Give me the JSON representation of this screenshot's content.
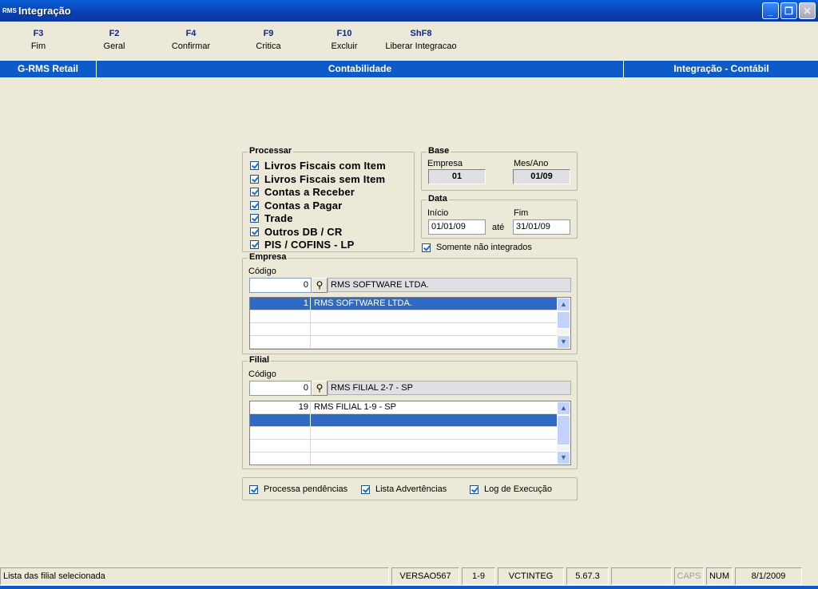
{
  "window": {
    "title": "Integração",
    "app_icon_text": "RMS"
  },
  "fkeys": [
    {
      "key": "F3",
      "label": "Fim"
    },
    {
      "key": "F2",
      "label": "Geral"
    },
    {
      "key": "F4",
      "label": "Confirmar"
    },
    {
      "key": "F9",
      "label": "Critica"
    },
    {
      "key": "F10",
      "label": "Excluir"
    },
    {
      "key": "ShF8",
      "label": "Liberar Integracao"
    }
  ],
  "header": {
    "left": "G-RMS Retail",
    "center": "Contabilidade",
    "right": "Integração - Contábil"
  },
  "processar": {
    "title": "Processar",
    "items": [
      "Livros Fiscais com Item",
      "Livros Fiscais sem Item",
      "Contas a Receber",
      "Contas a Pagar",
      "Trade",
      "Outros DB / CR",
      "PIS / COFINS - LP"
    ]
  },
  "base": {
    "title": "Base",
    "empresa_label": "Empresa",
    "empresa_value": "01",
    "mesano_label": "Mes/Ano",
    "mesano_value": "01/09"
  },
  "data": {
    "title": "Data",
    "inicio_label": "Início",
    "inicio_value": "01/01/09",
    "ate": "até",
    "fim_label": "Fim",
    "fim_value": "31/01/09"
  },
  "somente": "Somente não integrados",
  "empresa": {
    "title": "Empresa",
    "codigo_label": "Código",
    "codigo_value": "0",
    "name": "RMS SOFTWARE LTDA.",
    "rows": [
      {
        "code": "1",
        "name": "RMS SOFTWARE LTDA."
      }
    ]
  },
  "filial": {
    "title": "Filial",
    "codigo_label": "Código",
    "codigo_value": "0",
    "name": "RMS FILIAL 2-7 - SP",
    "rows": [
      {
        "code": "19",
        "name": "RMS FILIAL 1-9 - SP"
      }
    ]
  },
  "options": {
    "pendencias": "Processa pendências",
    "advertencias": "Lista Advertências",
    "log": "Log de Execução"
  },
  "status": {
    "message": "Lista das filial selecionada",
    "versao": "VERSAO567",
    "filial": "1-9",
    "program": "VCTINTEG",
    "build": "5.67.3",
    "caps": "CAPS",
    "num": "NUM",
    "date": "8/1/2009"
  }
}
